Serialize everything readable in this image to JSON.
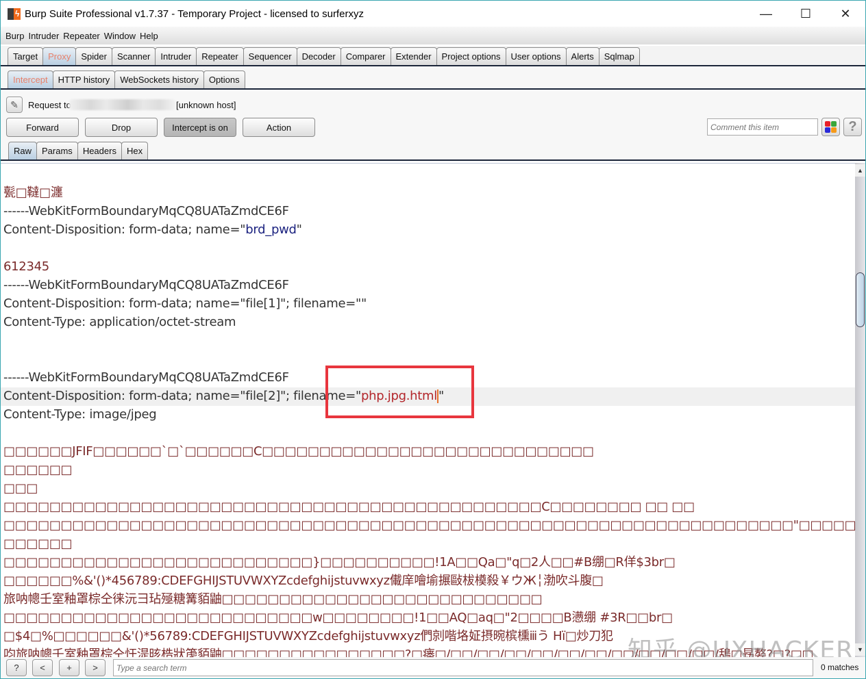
{
  "window": {
    "title": "Burp Suite Professional v1.7.37 - Temporary Project - licensed to surferxyz",
    "controls": {
      "minimize": "—",
      "maximize": "☐",
      "close": "✕"
    }
  },
  "menu": [
    "Burp",
    "Intruder",
    "Repeater",
    "Window",
    "Help"
  ],
  "main_tabs": [
    {
      "label": "Target",
      "active": false
    },
    {
      "label": "Proxy",
      "active": true
    },
    {
      "label": "Spider",
      "active": false
    },
    {
      "label": "Scanner",
      "active": false
    },
    {
      "label": "Intruder",
      "active": false
    },
    {
      "label": "Repeater",
      "active": false
    },
    {
      "label": "Sequencer",
      "active": false
    },
    {
      "label": "Decoder",
      "active": false
    },
    {
      "label": "Comparer",
      "active": false
    },
    {
      "label": "Extender",
      "active": false
    },
    {
      "label": "Project options",
      "active": false
    },
    {
      "label": "User options",
      "active": false
    },
    {
      "label": "Alerts",
      "active": false
    },
    {
      "label": "Sqlmap",
      "active": false
    }
  ],
  "sub_tabs": [
    {
      "label": "Intercept",
      "active": true
    },
    {
      "label": "HTTP history",
      "active": false
    },
    {
      "label": "WebSockets history",
      "active": false
    },
    {
      "label": "Options",
      "active": false
    }
  ],
  "intercept": {
    "request_label": "Request to",
    "host_suffix": "[unknown host]",
    "buttons": {
      "forward": "Forward",
      "drop": "Drop",
      "intercept": "Intercept is on",
      "action": "Action"
    },
    "comment_placeholder": "Comment this item",
    "help": "?",
    "highlight_colors": [
      "#e8202a",
      "#3aa63a",
      "#2a2ad8",
      "#f59a1a"
    ]
  },
  "view_tabs": [
    {
      "label": "Raw",
      "active": true
    },
    {
      "label": "Params",
      "active": false
    },
    {
      "label": "Headers",
      "active": false
    },
    {
      "label": "Hex",
      "active": false
    }
  ],
  "editor": {
    "lines": [
      {
        "text": "甏□韃□瀍",
        "style": "red"
      },
      {
        "text": "------WebKitFormBoundaryMqCQ8UATaZmdCE6F",
        "style": "plain"
      },
      {
        "pre": "Content-Disposition: form-data; name=\"",
        "name": "brd_pwd",
        "post": "\"",
        "style": "plain"
      },
      {
        "text": "",
        "style": "plain"
      },
      {
        "text": "612345",
        "style": "red"
      },
      {
        "text": "------WebKitFormBoundaryMqCQ8UATaZmdCE6F",
        "style": "plain"
      },
      {
        "text": "Content-Disposition: form-data; name=\"file[1]\"; filename=\"\"",
        "style": "plain"
      },
      {
        "text": "Content-Type: application/octet-stream",
        "style": "plain"
      },
      {
        "text": "",
        "style": "plain"
      },
      {
        "text": "",
        "style": "plain"
      },
      {
        "text": "------WebKitFormBoundaryMqCQ8UATaZmdCE6F",
        "style": "plain"
      },
      {
        "pre": "Content-Disposition: form-data; name=\"file[2]\"; filename=\"",
        "value": "php.jpg.html",
        "post": "\"",
        "style": "plain",
        "highlighted": true
      },
      {
        "text": "Content-Type: image/jpeg",
        "style": "plain"
      },
      {
        "text": "",
        "style": "plain"
      },
      {
        "text": "□□□□□□JFIF□□□□□□`□`□□□□□□C□□□□□□□□□□□□□□□□□□□□□□□□□□□□□",
        "style": "red"
      },
      {
        "text": "□□□□□□",
        "style": "red"
      },
      {
        "text": "□□□",
        "style": "red"
      },
      {
        "text": "□□□□□□□□□□□□□□□□□□□□□□□□□□□□□□□□□□□□□□□□□□□□□□□C□□□□□□□□    □□  □□",
        "style": "red"
      },
      {
        "text": "□□□□□□□□□□□□□□□□□□□□□□□□□□□□□□□□□□□□□□□□□□□□□□□□□□□□□□□□□□□□□□□□□□□□□\"□□□□□□□□□□□□□□□□□□□□□□□□□□□□□□□□□□□□□□",
        "style": "red"
      },
      {
        "text": "□□□□□□",
        "style": "red"
      },
      {
        "text": "□□□□□□□□□□□□□□□□□□□□□□□□□□□}□□□□□□□□□□!1A□□Qa□\"q□2人□□#B绷□R佯$3br□",
        "style": "red"
      },
      {
        "text": "□□□□□□%&'()*456789:CDEFGHIJSTUVWXYZcdefghijstuvwxyz儎庠噲堬搌敺柭橂殺￥ウЖ╎渤吹斗腹□",
        "style": "red"
      },
      {
        "text": "旅呐幒壬室釉罩棕仝徕沅彐玷殛糖篝貊鼬□□□□□□□□□□□□□□□□□□□□□□□□□□□□",
        "style": "red"
      },
      {
        "text": "□□□□□□□□□□□□□□□□□□□□□□□□□□□w□□□□□□□□!1□□AQ□aq□\"2□□□□B懑绷  #3R□□br□",
        "style": "red"
      },
      {
        "text": "□$4□%□□□□□□&'()*56789:CDEFGHIJSTUVWXYZcdefghijstuvwxyz們剠喈垎姃摂晼槟櫄ⅲう Hï□炒刀犯",
        "style": "red"
      },
      {
        "text": "呁旅呐幒壬室釉罩棕仝忓湜晐梏狀箎貊鼬□□□□□□□□□□□□□□□□?□瘗□/□□/□□/□□/□□/□□/□□/□□/□□/□□/□□/鴰□昮嫯?□?□□",
        "style": "red"
      }
    ],
    "watermark": "知乎 @UXHACKER"
  },
  "search": {
    "help": "?",
    "prev": "<",
    "add": "+",
    "next": ">",
    "placeholder": "Type a search term",
    "matches": "0 matches"
  }
}
